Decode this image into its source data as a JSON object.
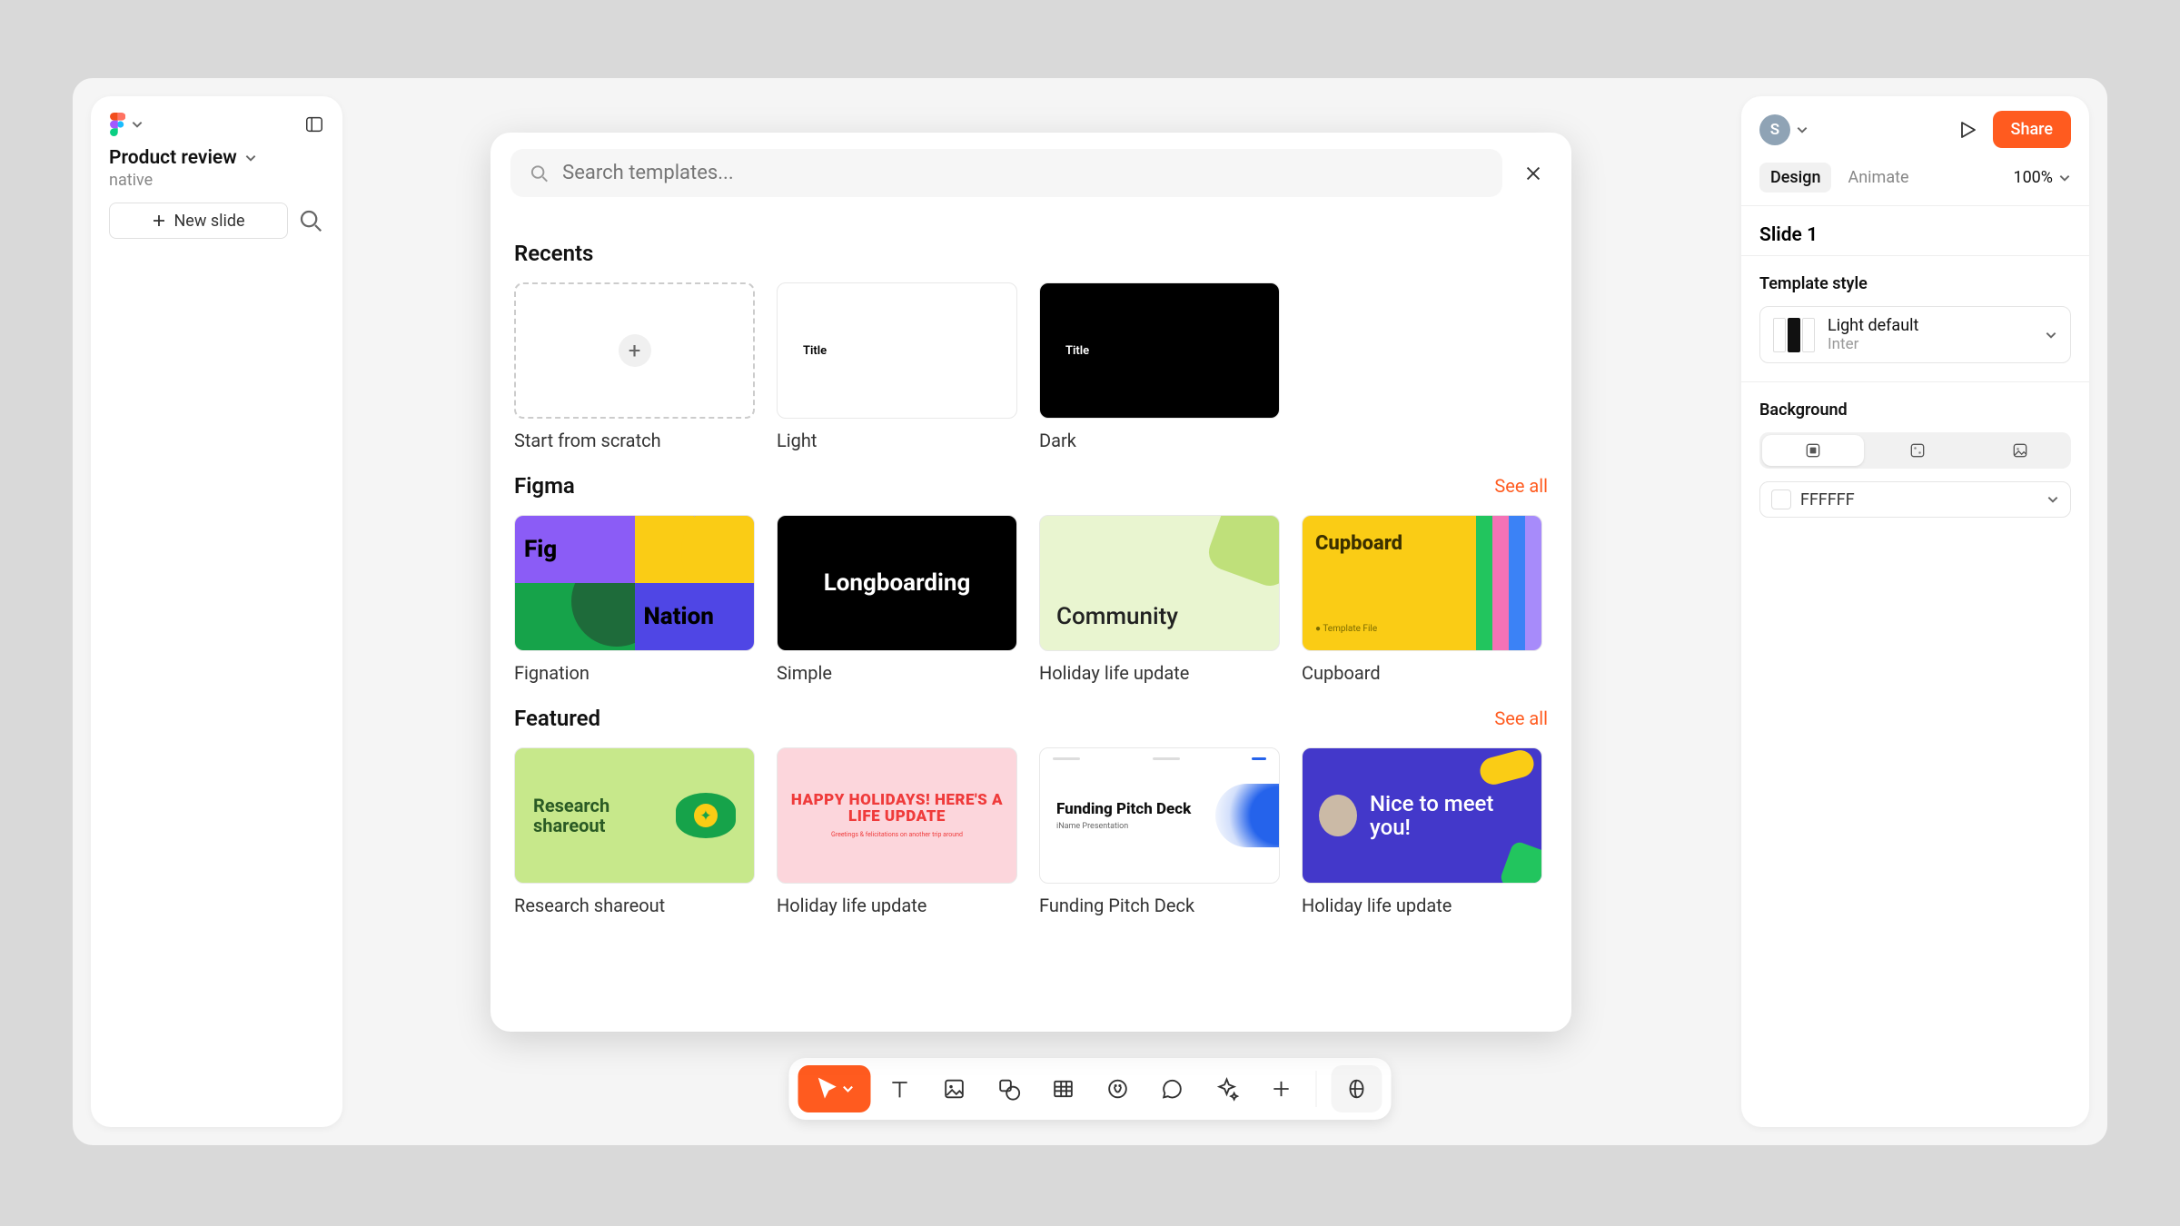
{
  "left": {
    "doc_title": "Product review",
    "doc_subtitle": "native",
    "new_slide": "New slide"
  },
  "right": {
    "avatar_initial": "S",
    "share": "Share",
    "tabs": {
      "design": "Design",
      "animate": "Animate"
    },
    "zoom": "100%",
    "slide_title": "Slide 1",
    "template_section": "Template style",
    "template_name": "Light default",
    "template_font": "Inter",
    "background_section": "Background",
    "bg_color": "FFFFFF"
  },
  "modal": {
    "search_placeholder": "Search templates...",
    "sections": {
      "recents": {
        "title": "Recents",
        "items": [
          "Start from scratch",
          "Light",
          "Dark"
        ]
      },
      "figma": {
        "title": "Figma",
        "see_all": "See all",
        "items": [
          "Fignation",
          "Simple",
          "Holiday life update",
          "Cupboard"
        ]
      },
      "featured": {
        "title": "Featured",
        "see_all": "See all",
        "items": [
          "Research shareout",
          "Holiday life update",
          "Funding Pitch Deck",
          "Holiday life update"
        ]
      }
    },
    "thumbtext": {
      "title_placeholder": "Title",
      "fignation_a": "Fig",
      "fignation_d": "Nation",
      "simple": "Longboarding",
      "community": "Community",
      "cupboard": "Cupboard",
      "cupboard_sub": "● Template File",
      "research": "Research shareout",
      "holiday": "HAPPY HOLIDAYS! HERE'S A LIFE UPDATE",
      "holiday_sub": "Greetings & felicitations on another trip around",
      "funding_t": "Funding Pitch Deck",
      "funding_s": "iName Presentation",
      "nice": "Nice to meet you!"
    }
  }
}
